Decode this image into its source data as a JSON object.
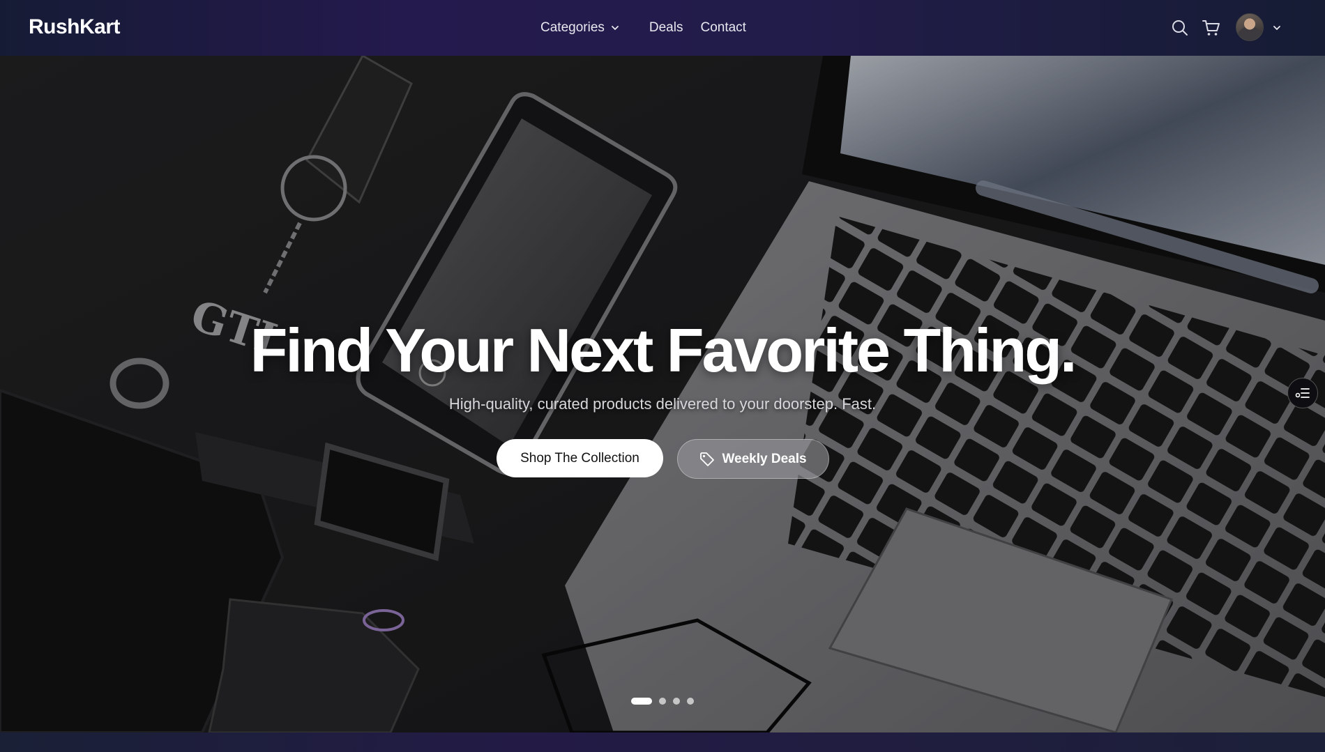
{
  "brand": {
    "name": "RushKart"
  },
  "nav": {
    "links": [
      {
        "label": "Categories",
        "has_dropdown": true
      },
      {
        "label": "Deals"
      },
      {
        "label": "Contact"
      }
    ]
  },
  "header_icons": [
    "search-icon",
    "cart-icon",
    "avatar",
    "chevron-down-icon"
  ],
  "hero": {
    "title": "Find Your Next Favorite Thing.",
    "subtitle": "High-quality, curated products delivered to your doorstep. Fast.",
    "primary_cta": "Shop The Collection",
    "secondary_cta": "Weekly Deals",
    "secondary_cta_icon": "tag-icon",
    "carousel": {
      "slides": 4,
      "active_index": 0
    }
  },
  "colors": {
    "nav_background": "#241a4d",
    "primary_button": "#ffffff",
    "secondary_button": "#8e8e93"
  }
}
